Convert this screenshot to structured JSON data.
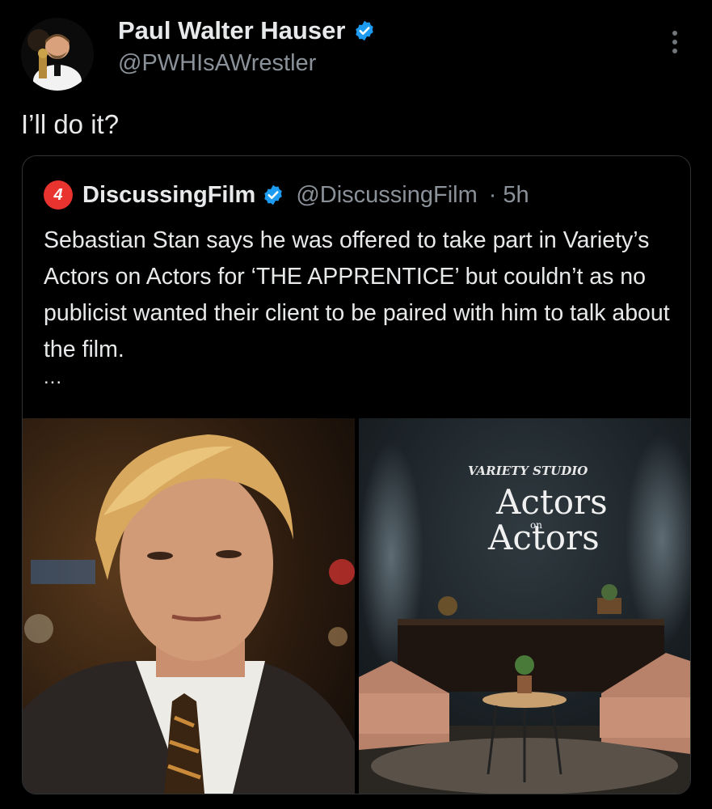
{
  "tweet": {
    "author_name": "Paul Walter Hauser",
    "author_handle": "@PWHIsAWrestler",
    "text": "I’ll do it?"
  },
  "quoted": {
    "logo_text": "4",
    "author_name": "DiscussingFilm",
    "author_handle": "@DiscussingFilm",
    "separator": "·",
    "time": "5h",
    "text": "Sebastian Stan says he was offered to take part in Variety’s Actors on Actors for ‘THE APPRENTICE’ but couldn’t as no publicist wanted their client to be paired with him to talk about the film.",
    "ellipsis": "...",
    "brand_color": "#e8332e",
    "set_sign": {
      "brand": "VARIETY STUDIO",
      "line1": "Actors",
      "line2": "on",
      "line3": "Actors"
    }
  },
  "colors": {
    "background": "#000000",
    "text": "#e7e9ea",
    "secondary_text": "#8b9199",
    "verified": "#1d9bf0",
    "border": "#2f3336"
  },
  "icons": [
    "verified-badge-icon",
    "more-options-icon"
  ]
}
